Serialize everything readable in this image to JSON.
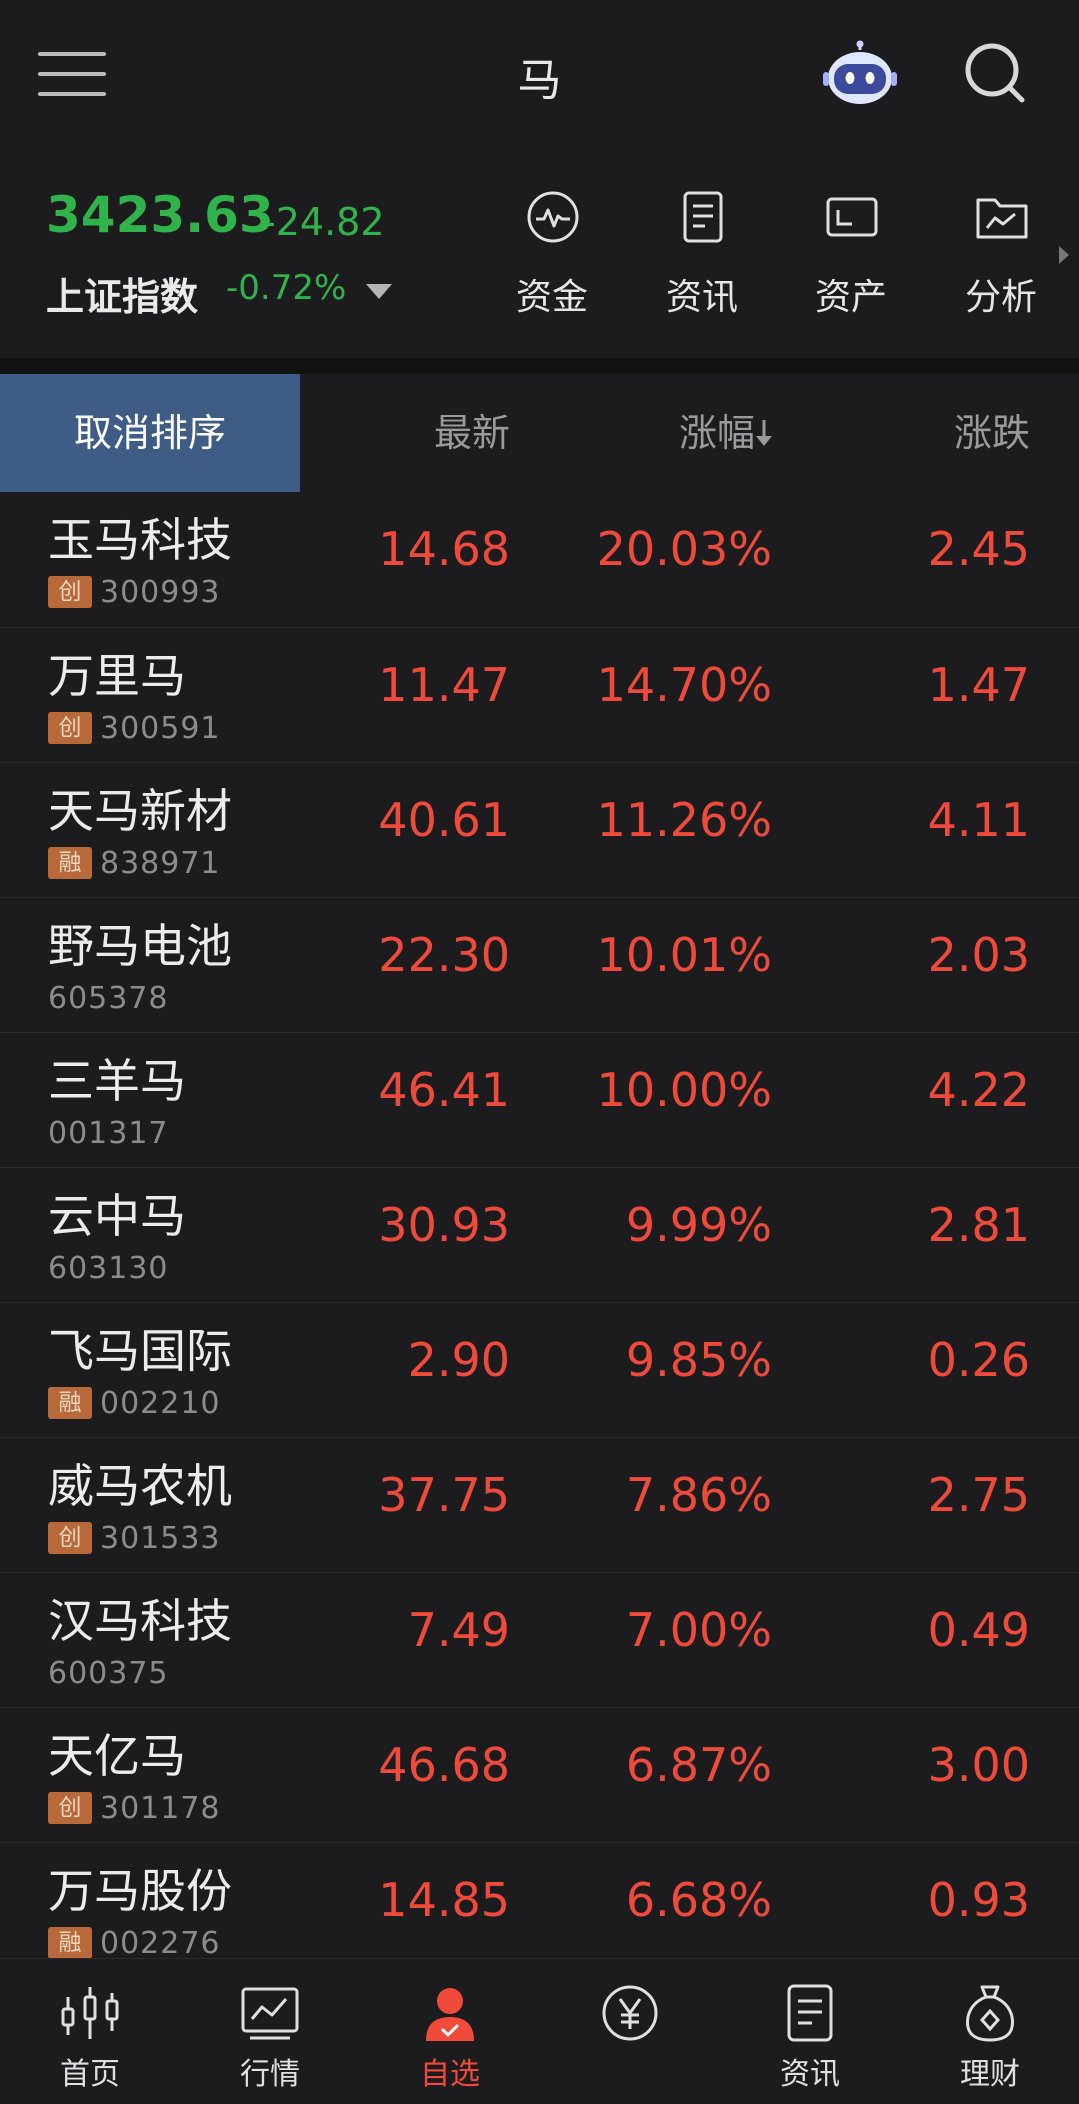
{
  "header": {
    "title": "马"
  },
  "index": {
    "value": "3423.63",
    "change": "-24.82",
    "name": "上证指数",
    "change_pct": "-0.72%"
  },
  "quick_menu": [
    {
      "label": "资金",
      "icon": "pulse-chart-icon"
    },
    {
      "label": "资讯",
      "icon": "document-icon"
    },
    {
      "label": "资产",
      "icon": "wallet-icon"
    },
    {
      "label": "分析",
      "icon": "folder-chart-icon"
    }
  ],
  "columns": {
    "cancel_sort": "取消排序",
    "latest": "最新",
    "change_pct": "涨幅",
    "change": "涨跌"
  },
  "stocks": [
    {
      "name": "玉马科技",
      "badge": "创",
      "code": "300993",
      "latest": "14.68",
      "change_pct": "20.03%",
      "change": "2.45"
    },
    {
      "name": "万里马",
      "badge": "创",
      "code": "300591",
      "latest": "11.47",
      "change_pct": "14.70%",
      "change": "1.47"
    },
    {
      "name": "天马新材",
      "badge": "融",
      "code": "838971",
      "latest": "40.61",
      "change_pct": "11.26%",
      "change": "4.11"
    },
    {
      "name": "野马电池",
      "badge": "",
      "code": "605378",
      "latest": "22.30",
      "change_pct": "10.01%",
      "change": "2.03"
    },
    {
      "name": "三羊马",
      "badge": "",
      "code": "001317",
      "latest": "46.41",
      "change_pct": "10.00%",
      "change": "4.22"
    },
    {
      "name": "云中马",
      "badge": "",
      "code": "603130",
      "latest": "30.93",
      "change_pct": "9.99%",
      "change": "2.81"
    },
    {
      "name": "飞马国际",
      "badge": "融",
      "code": "002210",
      "latest": "2.90",
      "change_pct": "9.85%",
      "change": "0.26"
    },
    {
      "name": "威马农机",
      "badge": "创",
      "code": "301533",
      "latest": "37.75",
      "change_pct": "7.86%",
      "change": "2.75"
    },
    {
      "name": "汉马科技",
      "badge": "",
      "code": "600375",
      "latest": "7.49",
      "change_pct": "7.00%",
      "change": "0.49"
    },
    {
      "name": "天亿马",
      "badge": "创",
      "code": "301178",
      "latest": "46.68",
      "change_pct": "6.87%",
      "change": "3.00"
    },
    {
      "name": "万马股份",
      "badge": "融",
      "code": "002276",
      "latest": "14.85",
      "change_pct": "6.68%",
      "change": "0.93"
    }
  ],
  "tabs": [
    {
      "label": "首页",
      "icon": "candlestick-icon"
    },
    {
      "label": "行情",
      "icon": "line-chart-icon"
    },
    {
      "label": "自选",
      "icon": "user-check-icon"
    },
    {
      "label": "",
      "icon": "yen-coin-icon"
    },
    {
      "label": "资讯",
      "icon": "document-icon"
    },
    {
      "label": "理财",
      "icon": "money-bag-icon"
    }
  ],
  "colors": {
    "up": "#f04b3a",
    "down": "#2fb34a",
    "accent": "#3e5c86",
    "background": "#1c1c1e"
  }
}
